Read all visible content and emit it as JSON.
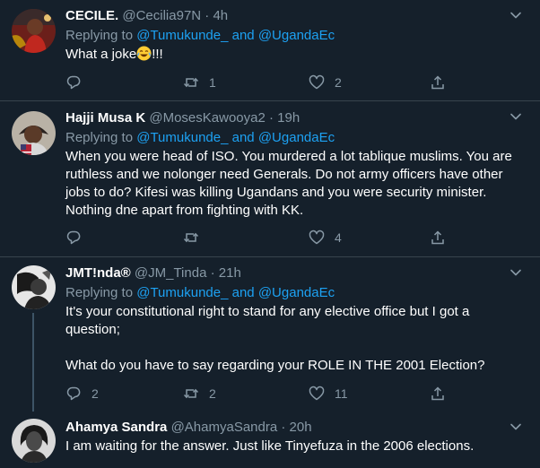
{
  "tweets": [
    {
      "name": "CECILE.",
      "handle": "@Cecilia97N",
      "dot": "·",
      "time": "4h",
      "replying_prefix": "Replying to",
      "mention1": "@Tumukunde_",
      "and": "and",
      "mention2": "@UgandaEc",
      "text_before_emoji": "What a joke",
      "emoji_icon": "face-with-tears-of-joy-icon",
      "text_after_emoji": "!!!",
      "reply_count": "",
      "retweet_count": "1",
      "like_count": "2"
    },
    {
      "name": "Hajji Musa K",
      "handle": "@MosesKawooya2",
      "dot": "·",
      "time": "19h",
      "replying_prefix": "Replying to",
      "mention1": "@Tumukunde_",
      "and": "and",
      "mention2": "@UgandaEc",
      "text": "When you were head of ISO. You murdered a lot tablique muslims. You are ruthless and we nolonger need Generals. Do not army officers have other jobs to do? Kifesi was killing Ugandans and you were security minister. Nothing dne apart from fighting with KK.",
      "reply_count": "",
      "retweet_count": "",
      "like_count": "4"
    },
    {
      "name": "JMT!nda®",
      "handle": "@JM_Tinda",
      "dot": "·",
      "time": "21h",
      "replying_prefix": "Replying to",
      "mention1": "@Tumukunde_",
      "and": "and",
      "mention2": "@UgandaEc",
      "text_p1": "It's your constitutional right to stand for any elective office but I got a question;",
      "text_p2": "What do you have to say regarding your ROLE IN THE 2001 Election?",
      "reply_count": "2",
      "retweet_count": "2",
      "like_count": "11"
    },
    {
      "name": "Ahamya Sandra",
      "handle": "@AhamyaSandra",
      "dot": "·",
      "time": "20h",
      "text": "I am waiting for the answer. Just like Tinyefuza in the 2006 elections."
    }
  ],
  "icons": {
    "reply": "reply-icon",
    "retweet": "retweet-icon",
    "like": "heart-icon",
    "share": "share-icon",
    "menu": "chevron-down-icon"
  },
  "colors": {
    "background": "#15202b",
    "divider": "#38444d",
    "secondary_text": "#8899a6",
    "link": "#1da1f2",
    "thread_line": "#3d5466"
  }
}
